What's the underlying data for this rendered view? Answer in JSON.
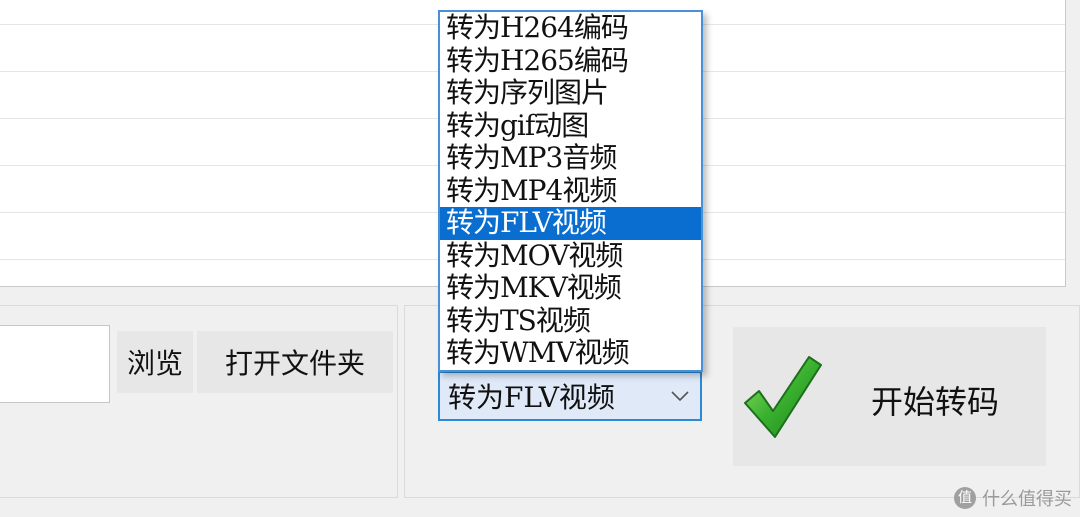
{
  "file_list": {
    "rows": 6
  },
  "output": {
    "path_value": "",
    "browse_label": "浏览",
    "open_folder_label": "打开文件夹"
  },
  "format_select": {
    "selected": "转为FLV视频",
    "options": [
      "转为H264编码",
      "转为H265编码",
      "转为序列图片",
      "转为gif动图",
      "转为MP3音频",
      "转为MP4视频",
      "转为FLV视频",
      "转为MOV视频",
      "转为MKV视频",
      "转为TS视频",
      "转为WMV视频"
    ],
    "selected_index": 6
  },
  "start": {
    "label": "开始转码",
    "icon": "checkmark-icon"
  },
  "watermark": {
    "text": "什么值得买",
    "icon": "smzdm-logo-icon"
  },
  "colors": {
    "accent": "#0a6ed1",
    "combo_border": "#2a8ad4",
    "check_green": "#2faa2f"
  }
}
